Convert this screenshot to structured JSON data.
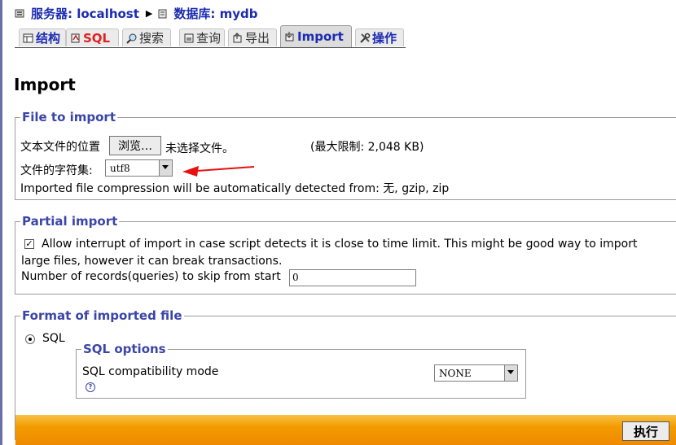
{
  "breadcrumb": {
    "server_label": "服务器: localhost",
    "database_label": "数据库: mydb"
  },
  "tabs": [
    {
      "label": "结构",
      "icon": "structure-icon",
      "active": false
    },
    {
      "label": "SQL",
      "icon": "sql-icon",
      "active": false
    },
    {
      "label": "搜索",
      "icon": "search-icon",
      "active": false
    },
    {
      "label": "查询",
      "icon": "query-icon",
      "active": false
    },
    {
      "label": "导出",
      "icon": "export-icon",
      "active": false
    },
    {
      "label": "Import",
      "icon": "import-icon",
      "active": true
    },
    {
      "label": "操作",
      "icon": "operations-icon",
      "active": false
    }
  ],
  "page_title": "Import",
  "file_to_import": {
    "legend": "File to import",
    "location_label": "文本文件的位置",
    "browse_button": "浏览…",
    "no_file_text": "未选择文件。",
    "max_limit": "(最大限制: 2,048 KB)",
    "charset_label": "文件的字符集:",
    "charset_value": "utf8",
    "compression_note": "Imported file compression will be automatically detected from: 无, gzip, zip"
  },
  "partial_import": {
    "legend": "Partial import",
    "allow_interrupt_checked": true,
    "allow_interrupt_line1": "Allow interrupt of import in case script detects it is close to time limit. This might be good way to import",
    "allow_interrupt_line2": "large files, however it can break transactions.",
    "skip_label": "Number of records(queries) to skip from start",
    "skip_value": "0"
  },
  "format": {
    "legend": "Format of imported file",
    "option_label": "SQL",
    "selected": "SQL",
    "sql_options": {
      "legend": "SQL options",
      "compat_label": "SQL compatibility mode",
      "compat_value": "NONE"
    }
  },
  "submit_button": "执行",
  "colors": {
    "link_blue": "#1c2cb0",
    "legend_blue": "#3a45a8",
    "sql_tab_red": "#dd2222",
    "orange_bar": "#f39b00",
    "annotation_arrow": "#e81010"
  }
}
